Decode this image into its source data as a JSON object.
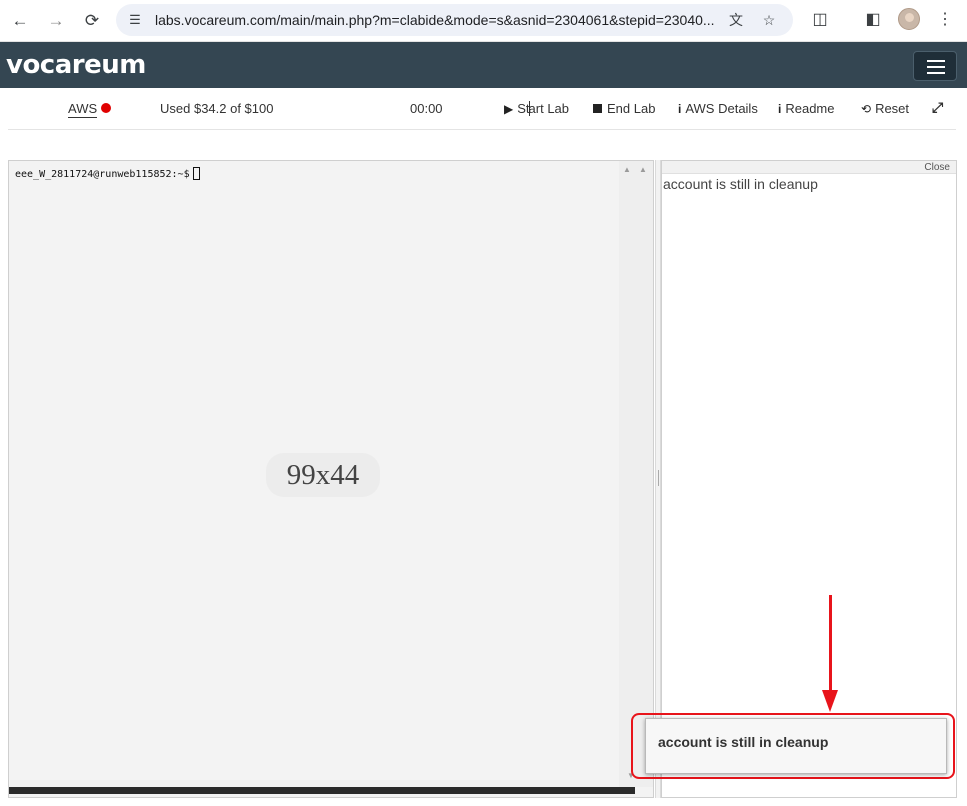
{
  "browser": {
    "url": "labs.vocareum.com/main/main.php?m=clabide&mode=s&asnid=2304061&stepid=23040...",
    "icons": [
      "back-arrow-icon",
      "forward-arrow-icon",
      "reload-icon",
      "site-settings-icon",
      "translate-icon",
      "star-icon",
      "extensions-icon",
      "side-panel-icon",
      "profile-avatar",
      "menu-dots-icon"
    ]
  },
  "header": {
    "logo": "vocareum"
  },
  "toolbar": {
    "aws_label": "AWS",
    "aws_status_color": "#e00000",
    "budget": "Used $34.2 of $100",
    "timer": "00:00",
    "start_lab_prefix": "St",
    "start_lab_suffix": "art Lab",
    "end_lab": "End Lab",
    "aws_details": "AWS Details",
    "readme": "Readme",
    "reset": "Reset"
  },
  "terminal": {
    "prompt": "eee_W_2811724@runweb115852:~$",
    "size": "99x44"
  },
  "side_panel": {
    "close": "Close",
    "message": "account is still in cleanup"
  },
  "toast": {
    "message": "account is still in cleanup"
  },
  "colors": {
    "header_bg": "#344652",
    "annotation_red": "#e8141b"
  }
}
